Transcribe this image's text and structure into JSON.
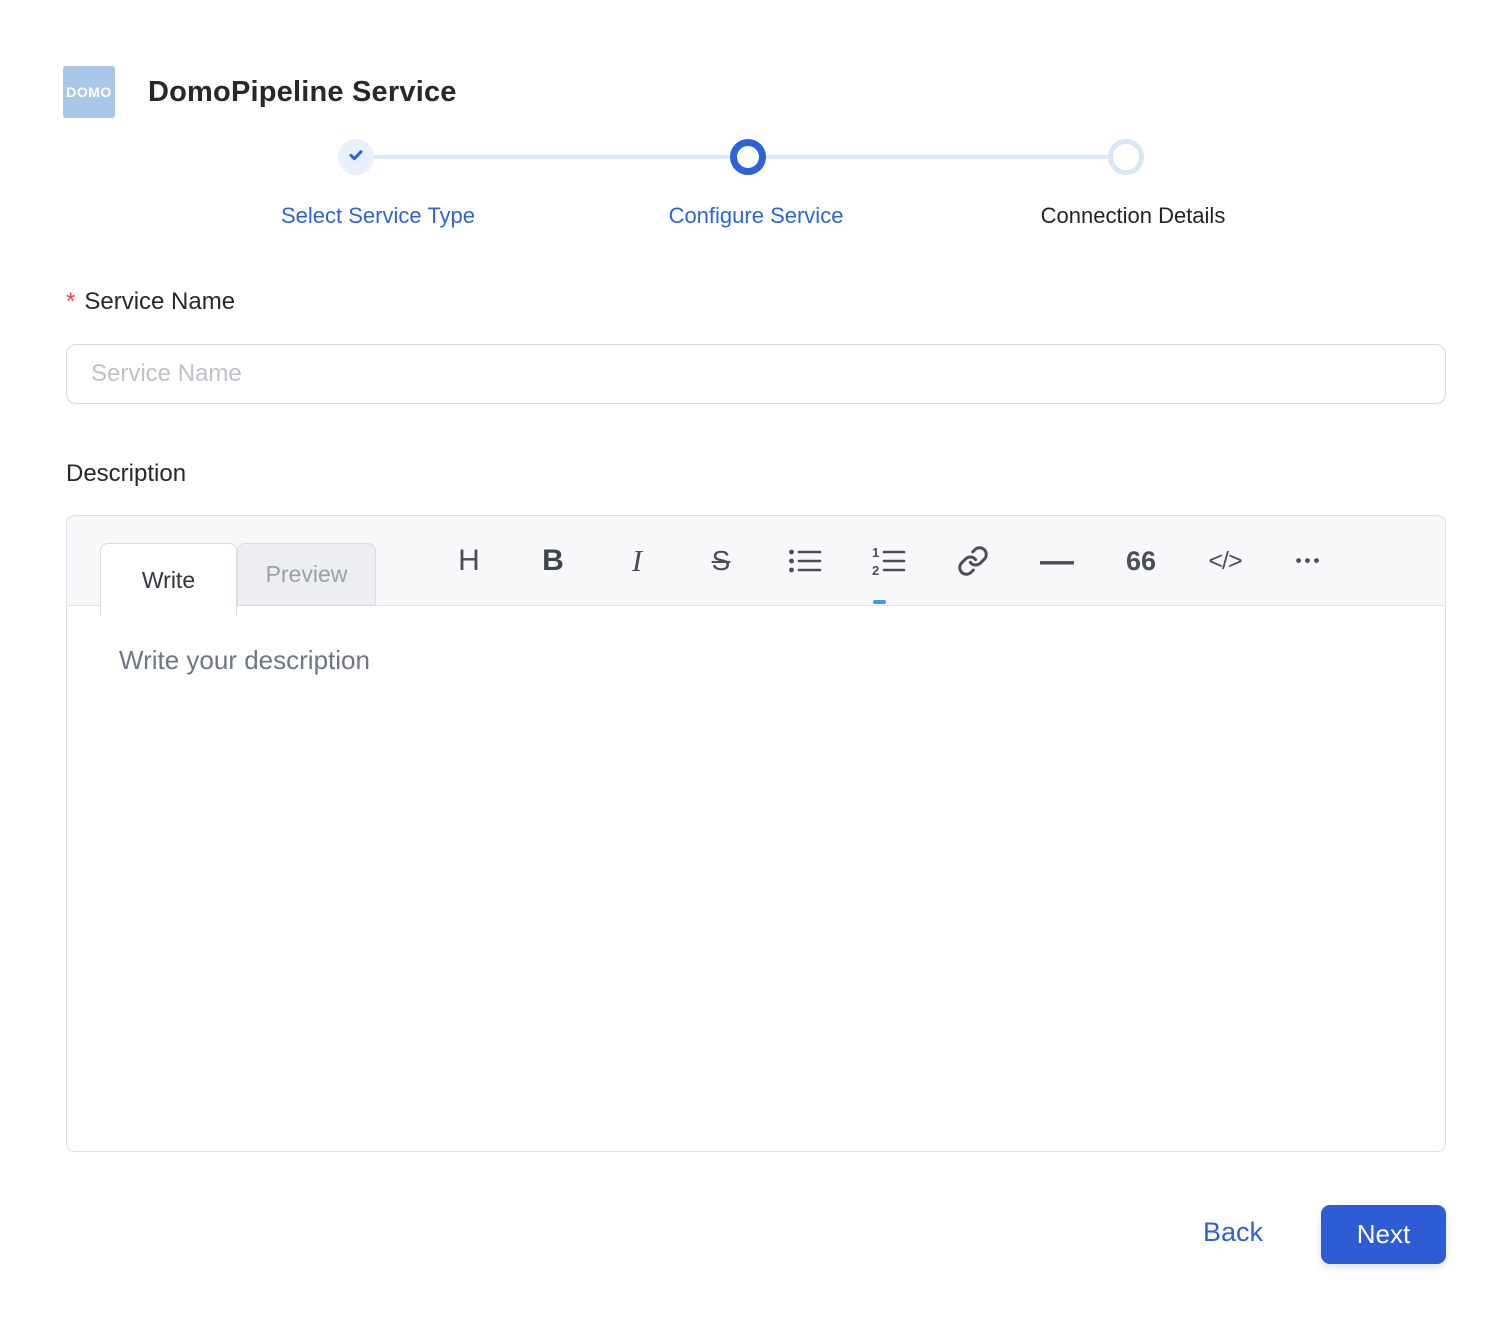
{
  "header": {
    "logo_text": "DOMO",
    "title": "DomoPipeline Service"
  },
  "stepper": {
    "steps": [
      {
        "label": "Select Service Type",
        "state": "completed"
      },
      {
        "label": "Configure Service",
        "state": "active"
      },
      {
        "label": "Connection Details",
        "state": "pending"
      }
    ]
  },
  "form": {
    "service_name": {
      "label": "Service Name",
      "required_marker": "*",
      "placeholder": "Service Name",
      "value": ""
    },
    "description": {
      "label": "Description",
      "placeholder": "Write your description",
      "value": ""
    }
  },
  "editor": {
    "tabs": [
      {
        "label": "Write"
      },
      {
        "label": "Preview"
      }
    ],
    "active_tab": "Write",
    "toolbar": [
      {
        "name": "heading-icon",
        "glyph": "H"
      },
      {
        "name": "bold-icon",
        "glyph": "B"
      },
      {
        "name": "italic-icon",
        "glyph": "I"
      },
      {
        "name": "strikethrough-icon",
        "glyph": "S"
      },
      {
        "name": "unordered-list-icon",
        "glyph": ""
      },
      {
        "name": "ordered-list-icon",
        "glyph": ""
      },
      {
        "name": "link-icon",
        "glyph": ""
      },
      {
        "name": "horizontal-rule-icon",
        "glyph": "—"
      },
      {
        "name": "quote-icon",
        "glyph": "66"
      },
      {
        "name": "code-icon",
        "glyph": "</>"
      },
      {
        "name": "more-icon",
        "glyph": "•••"
      }
    ]
  },
  "footer": {
    "back_label": "Back",
    "next_label": "Next"
  },
  "colors": {
    "accent_blue": "#2D63D8",
    "button_blue": "#2E5CD4",
    "logo_blue": "#A9C7E8",
    "step_done_bg": "#E7F0FC",
    "step_pending_ring": "#D7E5F7",
    "connector": "#DCE8F8",
    "required_red": "#EF4444",
    "editor_header_bg": "#F7F8FA",
    "border_gray": "#D9DEE7"
  }
}
